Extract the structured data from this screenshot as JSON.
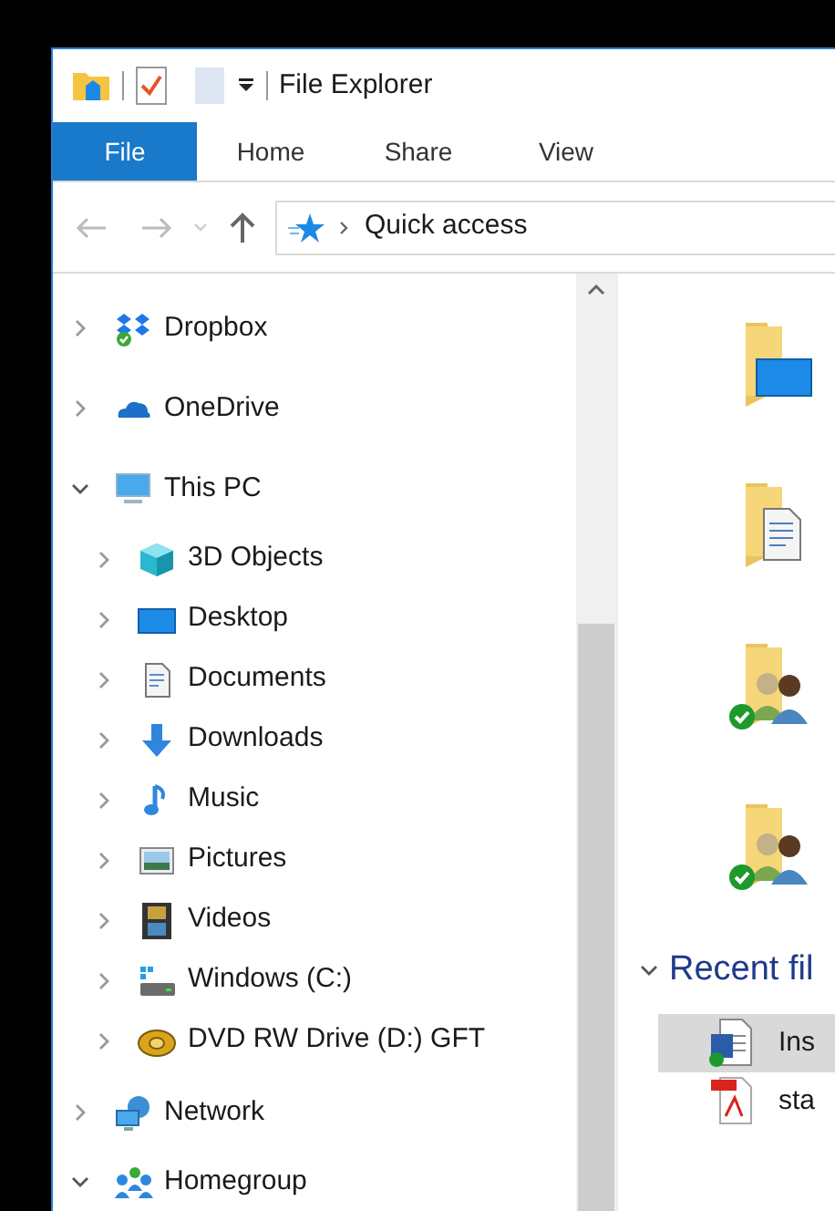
{
  "window": {
    "title": "File Explorer"
  },
  "ribbon_tabs": [
    {
      "label": "File",
      "selected": true
    },
    {
      "label": "Home",
      "selected": false
    },
    {
      "label": "Share",
      "selected": false
    },
    {
      "label": "View",
      "selected": false
    }
  ],
  "address_bar": {
    "path": "Quick access"
  },
  "navigation_tree": [
    {
      "label": "Dropbox",
      "kind": "dropbox",
      "expanded": false
    },
    {
      "label": "OneDrive",
      "kind": "onedrive",
      "expanded": false
    },
    {
      "label": "This PC",
      "kind": "pc",
      "expanded": true,
      "children": [
        {
          "label": "3D Objects",
          "kind": "cube",
          "expanded": false
        },
        {
          "label": "Desktop",
          "kind": "desktop",
          "expanded": false
        },
        {
          "label": "Documents",
          "kind": "documents",
          "expanded": false
        },
        {
          "label": "Downloads",
          "kind": "downloads",
          "expanded": false
        },
        {
          "label": "Music",
          "kind": "music",
          "expanded": false
        },
        {
          "label": "Pictures",
          "kind": "pictures",
          "expanded": false
        },
        {
          "label": "Videos",
          "kind": "videos",
          "expanded": false
        },
        {
          "label": "Windows (C:)",
          "kind": "drive",
          "expanded": false
        },
        {
          "label": "DVD RW Drive (D:) GFT",
          "kind": "disc",
          "expanded": false
        }
      ]
    },
    {
      "label": "Network",
      "kind": "network",
      "expanded": false
    },
    {
      "label": "Homegroup",
      "kind": "homegroup",
      "expanded": true
    }
  ],
  "quick_access": {
    "folders": [
      {
        "kind": "desktop",
        "synced": false
      },
      {
        "kind": "documents",
        "synced": false
      },
      {
        "kind": "people",
        "synced": true
      },
      {
        "kind": "people",
        "synced": true
      }
    ]
  },
  "recent_files": {
    "header": "Recent fil",
    "expanded": true,
    "files": [
      {
        "name": "Ins",
        "kind": "word",
        "selected": true
      },
      {
        "name": "sta",
        "kind": "pdf",
        "selected": false
      }
    ]
  }
}
